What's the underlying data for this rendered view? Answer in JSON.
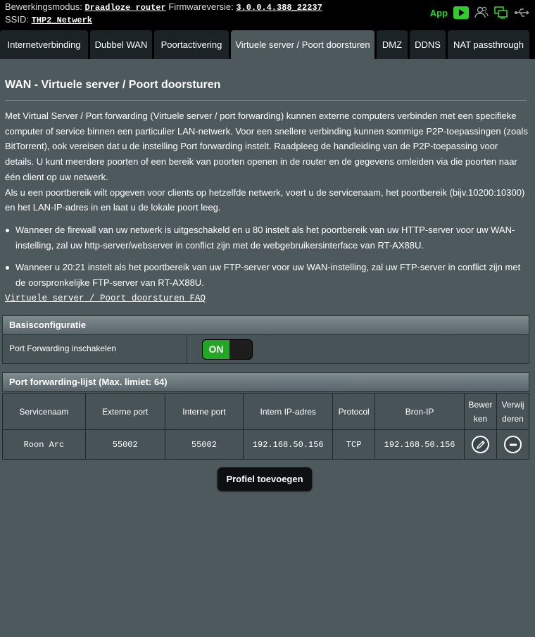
{
  "header": {
    "mode_label": "Bewerkingsmodus:",
    "mode_value": "Draadloze router",
    "firmware_label": "Firmwareversie:",
    "firmware_value": "3.0.0.4.388_22237",
    "ssid_label": "SSID:",
    "ssid_value": "THP2_Netwerk",
    "app_label": "App",
    "icons": [
      "play-icon",
      "users-icon",
      "network-status-icon",
      "usb-icon"
    ],
    "accent_color": "#2dcf2d"
  },
  "tabs": [
    {
      "label": "Internetverbinding",
      "active": false
    },
    {
      "label": "Dubbel WAN",
      "active": false
    },
    {
      "label": "Poortactivering",
      "active": false
    },
    {
      "label": "Virtuele server / Poort doorsturen",
      "active": true
    },
    {
      "label": "DMZ",
      "active": false
    },
    {
      "label": "DDNS",
      "active": false
    },
    {
      "label": "NAT passthrough",
      "active": false
    }
  ],
  "page": {
    "title": "WAN - Virtuele server / Poort doorsturen",
    "description_1": "Met Virtual Server / Port forwarding (Virtuele server / port forwarding) kunnen externe computers verbinden met een specifieke computer of service binnen een particulier LAN-netwerk. Voor een snellere verbinding kunnen sommige P2P-toepassingen (zoals BitTorrent), ook vereisen dat u de instelling Port forwarding instelt. Raadpleeg de handleiding van de P2P-toepassing voor details. U kunt meerdere poorten of een bereik van poorten openen in de router en de gegevens omleiden via die poorten naar één client op uw netwerk.",
    "description_2": "Als u een poortbereik wilt opgeven voor clients op hetzelfde netwerk, voert u de servicenaam, het poortbereik (bijv.10200:10300) en het LAN-IP-adres in en laat u de lokale poort leeg.",
    "bullets": [
      "Wanneer de firewall van uw netwerk is uitgeschakeld en u 80 instelt als het poortbereik van uw HTTP-server voor uw WAN-instelling, zal uw http-server/webserver in conflict zijn met de webgebruikersinterface van RT-AX88U.",
      "Wanneer u 20:21 instelt als het poortbereik van uw FTP-server voor uw WAN-instelling, zal uw FTP-server in conflict zijn met de oorspronkelijke FTP-server van RT-AX88U."
    ],
    "faq_link": "Virtuele server / Poort doorsturen FAQ"
  },
  "basic_config": {
    "header": "Basisconfiguratie",
    "enable_label": "Port Forwarding inschakelen",
    "toggle_state": "ON",
    "toggle_color": "#23a623"
  },
  "pf_list": {
    "header": "Port forwarding-lijst (Max. limiet: 64)",
    "columns": [
      "Servicenaam",
      "Externe port",
      "Interne port",
      "Intern IP-adres",
      "Protocol",
      "Bron-IP",
      "Bewer ken",
      "Verwij deren"
    ],
    "rows": [
      {
        "service": "Roon Arc",
        "external_port": "55002",
        "internal_port": "55002",
        "internal_ip": "192.168.50.156",
        "protocol": "TCP",
        "source_ip": "192.168.50.156"
      }
    ],
    "add_button": "Profiel toevoegen"
  }
}
